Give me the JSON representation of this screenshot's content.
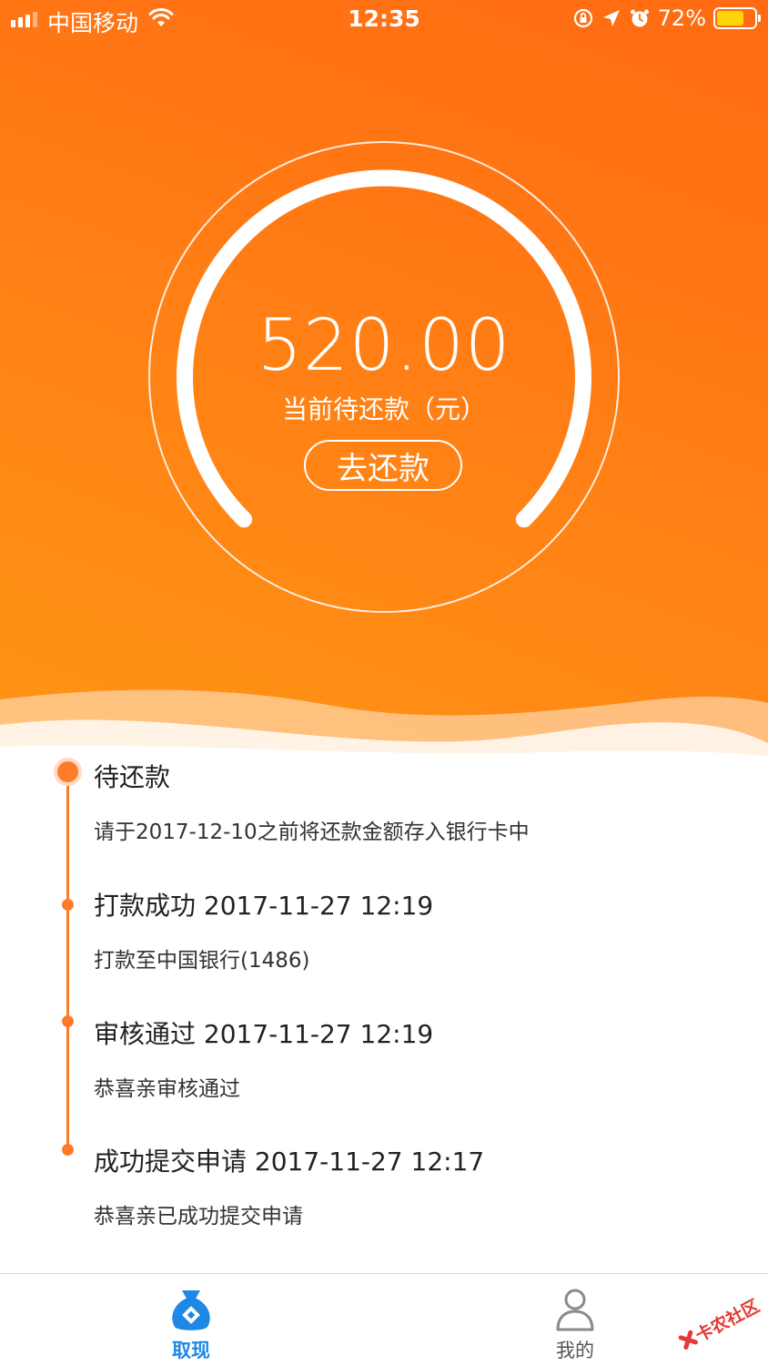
{
  "status_bar": {
    "carrier": "中国移动",
    "time": "12:35",
    "battery": "72%",
    "battery_level": 0.72
  },
  "loan": {
    "amount": "520.00",
    "amount_label": "当前待还款（元）",
    "repay_button": "去还款"
  },
  "timeline": [
    {
      "title": "待还款",
      "desc": "请于2017-12-10之前将还款金额存入银行卡中",
      "active": true
    },
    {
      "title": "打款成功 2017-11-27 12:19",
      "desc": "打款至中国银行(1486)",
      "active": false
    },
    {
      "title": "审核通过 2017-11-27 12:19",
      "desc": "恭喜亲审核通过",
      "active": false
    },
    {
      "title": "成功提交申请 2017-11-27 12:17",
      "desc": "恭喜亲已成功提交申请",
      "active": false
    }
  ],
  "tab_bar": {
    "withdraw": "取现",
    "mine": "我的"
  },
  "watermark": "卡农社区",
  "colors": {
    "accent": "#ff7b2a",
    "tab_active": "#1e88e5"
  }
}
